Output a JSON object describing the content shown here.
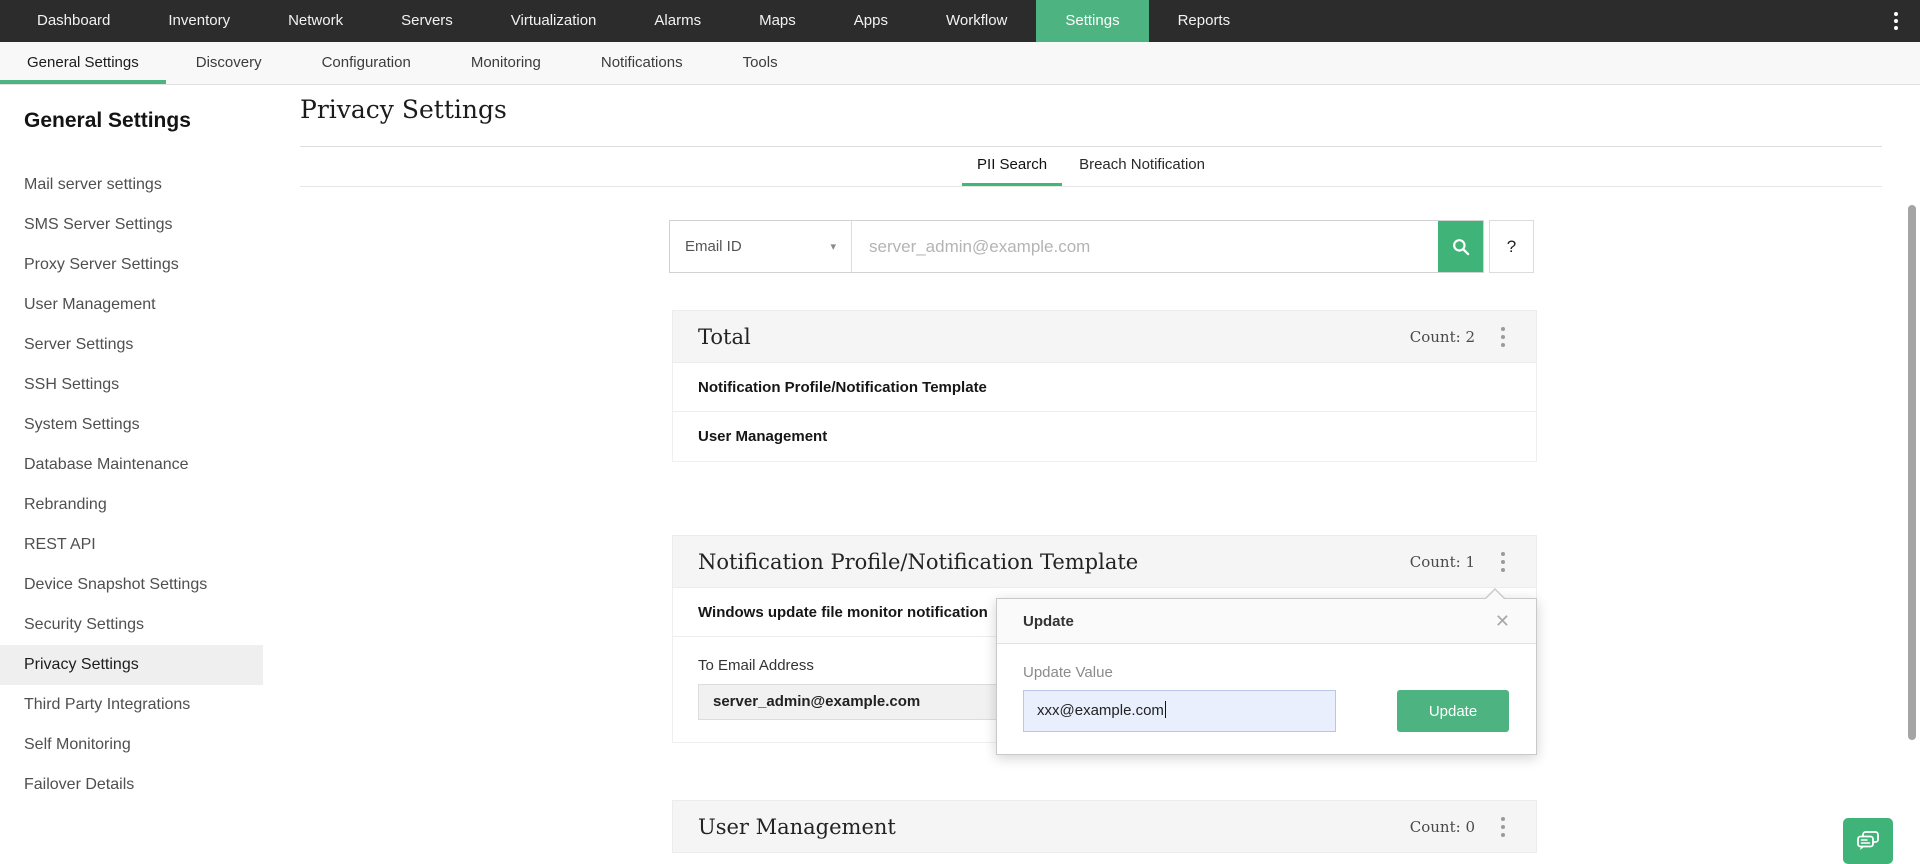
{
  "colors": {
    "accent": "#4db381",
    "nav_bg": "#2c2c2c",
    "tab_underline": "#3cb878"
  },
  "nav": {
    "active": "Settings",
    "items": [
      "Dashboard",
      "Inventory",
      "Network",
      "Servers",
      "Virtualization",
      "Alarms",
      "Maps",
      "Apps",
      "Workflow",
      "Settings",
      "Reports"
    ]
  },
  "subnav": {
    "active": "General Settings",
    "items": [
      "General Settings",
      "Discovery",
      "Configuration",
      "Monitoring",
      "Notifications",
      "Tools"
    ]
  },
  "sidebar": {
    "title": "General Settings",
    "active": "Privacy Settings",
    "items": [
      "Mail server settings",
      "SMS Server Settings",
      "Proxy Server Settings",
      "User Management",
      "Server Settings",
      "SSH Settings",
      "System Settings",
      "Database Maintenance",
      "Rebranding",
      "REST API",
      "Device Snapshot Settings",
      "Security Settings",
      "Privacy Settings",
      "Third Party Integrations",
      "Self Monitoring",
      "Failover Details"
    ]
  },
  "main": {
    "title": "Privacy Settings",
    "tabs": [
      {
        "label": "PII Search",
        "active": true
      },
      {
        "label": "Breach Notification",
        "active": false
      }
    ],
    "search": {
      "field_selector": "Email ID",
      "placeholder": "server_admin@example.com",
      "help_label": "?"
    },
    "sections": [
      {
        "title": "Total",
        "count_label": "Count: 2",
        "rows": [
          "Notification Profile/Notification Template",
          "User Management"
        ]
      },
      {
        "title": "Notification Profile/Notification Template",
        "count_label": "Count: 1",
        "rows": [
          "Windows update file monitor notification"
        ],
        "field_label": "To Email Address",
        "field_value": "server_admin@example.com"
      },
      {
        "title": "User Management",
        "count_label": "Count: 0"
      }
    ]
  },
  "popup": {
    "title": "Update",
    "field_label": "Update Value",
    "field_value": "xxx@example.com",
    "button_label": "Update"
  },
  "icons": {
    "close": "✕",
    "caret_down": "▾"
  }
}
